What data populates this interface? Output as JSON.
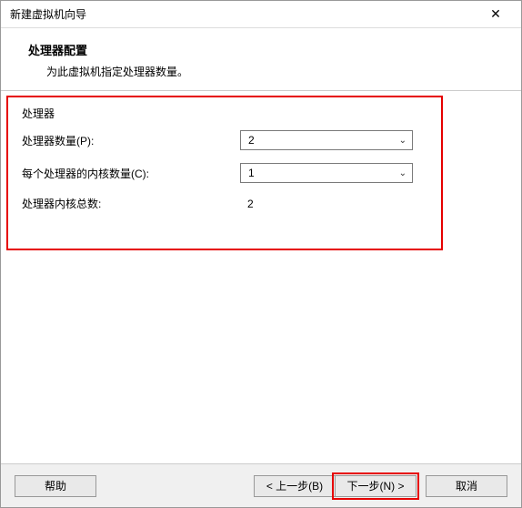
{
  "window": {
    "title": "新建虚拟机向导"
  },
  "header": {
    "title": "处理器配置",
    "subtitle": "为此虚拟机指定处理器数量。"
  },
  "group": {
    "label": "处理器",
    "rows": {
      "processors": {
        "label": "处理器数量(P):",
        "value": "2"
      },
      "cores": {
        "label": "每个处理器的内核数量(C):",
        "value": "1"
      },
      "total": {
        "label": "处理器内核总数:",
        "value": "2"
      }
    }
  },
  "buttons": {
    "help": "帮助",
    "back": "< 上一步(B)",
    "next": "下一步(N) >",
    "cancel": "取消"
  }
}
